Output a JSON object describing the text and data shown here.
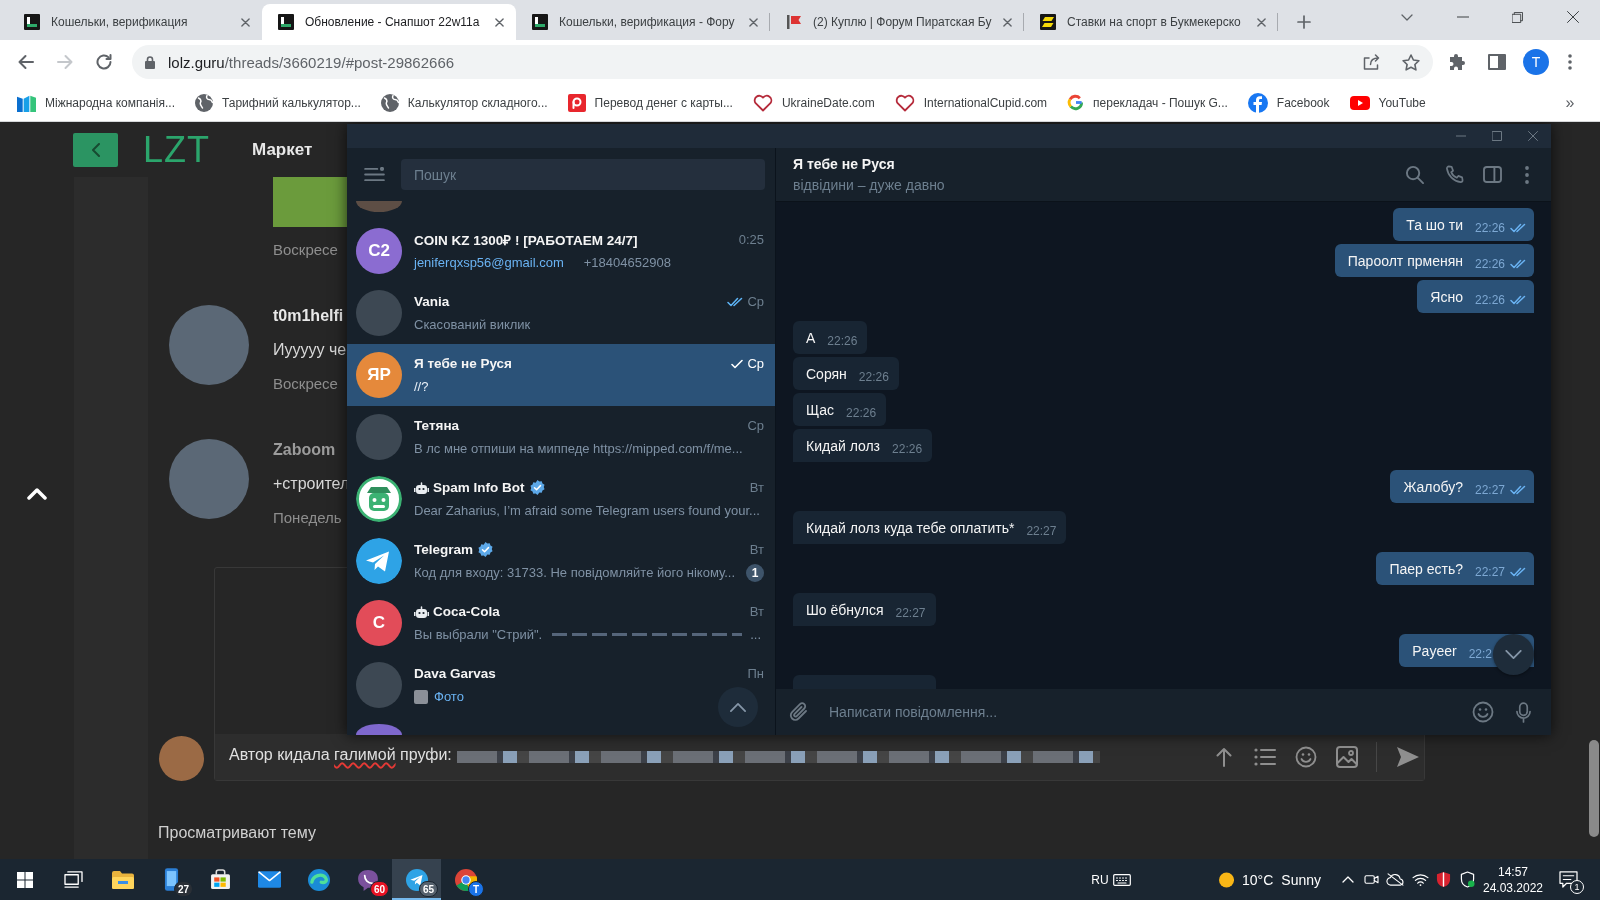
{
  "browser": {
    "tabs": [
      {
        "title": "Кошельки, верификация",
        "kind": "lolz",
        "selected": false
      },
      {
        "title": "Обновление - Снапшот 22w11a",
        "kind": "lolz",
        "selected": true
      },
      {
        "title": "Кошельки, верификация - Фору",
        "kind": "lolz",
        "selected": false
      },
      {
        "title": "(2) Куплю | Форум Пиратская Бу",
        "kind": "pirate",
        "selected": false
      },
      {
        "title": "Ставки на спорт в Букмекерско",
        "kind": "bet",
        "selected": false
      }
    ],
    "back": {
      "disabled": false
    },
    "forward": {
      "disabled": true
    },
    "address": {
      "host": "lolz.guru",
      "path": "/threads/3660219/#post-29862666"
    },
    "profile": {
      "initial": "T"
    },
    "bookmarks": [
      {
        "label": "Міжнародна компанія...",
        "kind": "m-logo"
      },
      {
        "label": "Тарифний калькулятор...",
        "kind": "globe"
      },
      {
        "label": "Калькулятор складного...",
        "kind": "globe"
      },
      {
        "label": "Перевод денег с карты...",
        "kind": "p-logo"
      },
      {
        "label": "UkraineDate.com",
        "kind": "heart"
      },
      {
        "label": "InternationalCupid.com",
        "kind": "heart"
      },
      {
        "label": "перекладач - Пошук G...",
        "kind": "google"
      },
      {
        "label": "Facebook",
        "kind": "facebook"
      },
      {
        "label": "YouTube",
        "kind": "youtube"
      }
    ],
    "bookmarks_more": "»"
  },
  "forum": {
    "logo": "LZT",
    "nav": [
      "Маркет"
    ],
    "posts": [
      {
        "kind": "image",
        "date": "Воскресе"
      },
      {
        "kind": "text",
        "author": "t0m1helfi",
        "color": "#e8e8e8",
        "text": "Иууууу че",
        "date": "Воскресе"
      },
      {
        "kind": "text",
        "author": "Zaboom",
        "color": "#9c9c9c",
        "text": "+строител",
        "date": "Понедель"
      }
    ],
    "reply": {
      "words": [
        {
          "text": "Автор",
          "misspelled": false
        },
        {
          "text": "кидала",
          "misspelled": false
        },
        {
          "text": "галимой",
          "misspelled": true
        },
        {
          "text": "пруфи:",
          "misspelled": false
        }
      ]
    },
    "viewers_heading": "Просматривают тему"
  },
  "telegram": {
    "search": {
      "placeholder": "Пошук"
    },
    "chats": [
      {
        "name": "COIN KZ 1300₽ ! [РАБОТАЕМ 24/7]",
        "time": "0:25",
        "avatar": {
          "kind": "initials",
          "text": "C2",
          "color": "#8b6cd1"
        },
        "preview": {
          "kind": "link",
          "link": "jeniferqxsp56@gmail.com",
          "text": "+18404652908"
        },
        "bot": false,
        "verified": false,
        "selected": false
      },
      {
        "name": "Vania",
        "time": "Ср",
        "read": true,
        "avatar": {
          "kind": "photo"
        },
        "preview": {
          "kind": "text",
          "text": "Скасований виклик"
        },
        "bot": false,
        "verified": false,
        "selected": false
      },
      {
        "name": "Я тебе не Руся",
        "time": "Ср",
        "read": false,
        "avatar": {
          "kind": "initials",
          "text": "ЯР",
          "color": "#e5893b"
        },
        "preview": {
          "kind": "text",
          "text": "//?"
        },
        "bot": false,
        "verified": false,
        "selected": true
      },
      {
        "name": "Тетяна",
        "time": "Ср",
        "avatar": {
          "kind": "photo"
        },
        "preview": {
          "kind": "text",
          "text": "В лс мне отпиши на миппеде https://mipped.com/f/me..."
        },
        "bot": false,
        "verified": false,
        "selected": false
      },
      {
        "name": "Spam Info Bot",
        "time": "Вт",
        "avatar": {
          "kind": "robot"
        },
        "preview": {
          "kind": "text",
          "text": "Dear Zaharius, I’m afraid some Telegram users found your..."
        },
        "bot": true,
        "verified": true,
        "selected": false
      },
      {
        "name": "Telegram",
        "time": "Вт",
        "avatar": {
          "kind": "plane"
        },
        "preview": {
          "kind": "text",
          "text": "Код для входу: 31733. Не повідомляйте його нікому..."
        },
        "unread": "1",
        "bot": false,
        "verified": true,
        "selected": false
      },
      {
        "name": "Coca-Cola",
        "time": "Вт",
        "avatar": {
          "kind": "initials",
          "text": "C",
          "color": "#e24c59"
        },
        "preview": {
          "kind": "dashes",
          "text": "Вы выбрали \"Стрий\".",
          "tail": "..."
        },
        "bot": true,
        "verified": false,
        "selected": false
      },
      {
        "name": "Dava Garvas",
        "time": "Пн",
        "avatar": {
          "kind": "photo"
        },
        "preview": {
          "kind": "photo",
          "text": "Фото"
        },
        "bot": false,
        "verified": false,
        "selected": false
      }
    ],
    "chat": {
      "title": "Я тебе не Руся",
      "status": "відвідини – дуже давно"
    },
    "messages": [
      {
        "kind": "text",
        "text": "Та шо ти",
        "time": "22:26",
        "outgoing": true,
        "read": true
      },
      {
        "kind": "text",
        "text": "Пароолт прменян",
        "time": "22:26",
        "outgoing": true,
        "read": true
      },
      {
        "kind": "text",
        "text": "Ясно",
        "time": "22:26",
        "outgoing": true,
        "read": true
      },
      {
        "kind": "text",
        "text": "А",
        "time": "22:26",
        "outgoing": false
      },
      {
        "kind": "text",
        "text": "Сорян",
        "time": "22:26",
        "outgoing": false
      },
      {
        "kind": "text",
        "text": "Щас",
        "time": "22:26",
        "outgoing": false
      },
      {
        "kind": "text",
        "text": "Кидай лолз",
        "time": "22:26",
        "outgoing": false
      },
      {
        "kind": "text",
        "text": "Жалобу?",
        "time": "22:27",
        "outgoing": true,
        "read": true
      },
      {
        "kind": "text",
        "text": "Кидай лолз куда тебе оплатить*",
        "time": "22:27",
        "outgoing": false
      },
      {
        "kind": "text",
        "text": "Паер есть?",
        "time": "22:27",
        "outgoing": true,
        "read": true
      },
      {
        "kind": "text",
        "text": "Шо ёбнулся",
        "time": "22:27",
        "outgoing": false
      },
      {
        "kind": "text",
        "text": "Payeer",
        "time": "22:2",
        "outgoing": true
      },
      {
        "kind": "clipped",
        "outgoing": false
      }
    ],
    "composer": {
      "placeholder": "Написати повідомлення..."
    }
  },
  "taskbar": {
    "apps": [
      {
        "kind": "start",
        "active": false
      },
      {
        "kind": "task-view",
        "active": false
      },
      {
        "kind": "folder",
        "active": false
      },
      {
        "kind": "phone",
        "badge": "27",
        "active": false
      },
      {
        "kind": "store",
        "active": false
      },
      {
        "kind": "mail",
        "active": false
      },
      {
        "kind": "edge",
        "active": false
      },
      {
        "kind": "viber",
        "badge": "60",
        "active": false
      },
      {
        "kind": "telegram",
        "badge": "65",
        "active": true
      },
      {
        "kind": "chrome",
        "badge": "T",
        "active": false
      }
    ],
    "language": "RU",
    "temperature": "10°C",
    "weather": "Sunny",
    "time": "14:57",
    "date": "24.03.2022",
    "notifications": "1"
  }
}
